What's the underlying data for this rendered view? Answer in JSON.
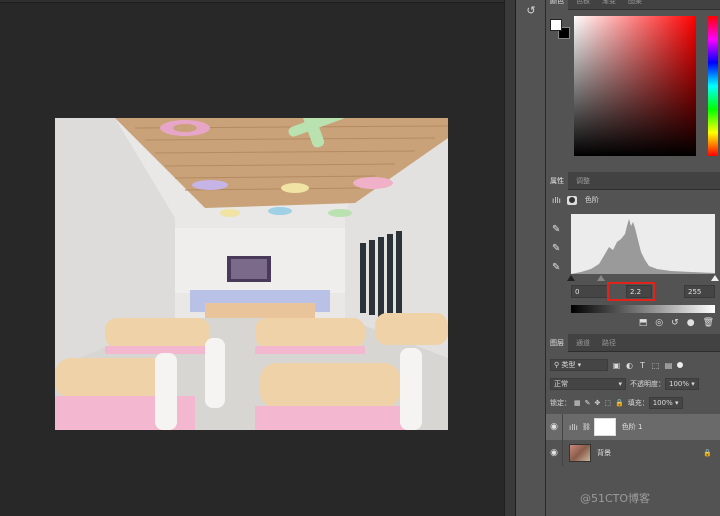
{
  "color_panel": {
    "tabs": [
      "颜色",
      "色板",
      "渐变",
      "图案"
    ],
    "foreground": "#ffffff",
    "background": "#000000"
  },
  "properties_panel": {
    "tabs": [
      "属性",
      "调整"
    ],
    "title": "色阶",
    "input_black": "0",
    "input_gamma": "2.2",
    "input_white": "255"
  },
  "layers_panel": {
    "tabs": [
      "图层",
      "通道",
      "路径"
    ],
    "filter_type": "类型",
    "blend_mode": "正常",
    "opacity_label": "不透明度：",
    "opacity_value": "100%",
    "lock_label": "锁定：",
    "fill_label": "填充：",
    "fill_value": "100%",
    "layers": [
      {
        "name": "色阶 1",
        "selected": true
      },
      {
        "name": "背景",
        "selected": false
      }
    ]
  },
  "watermark": "@51CTO博客",
  "accent_color": "#e2231a"
}
